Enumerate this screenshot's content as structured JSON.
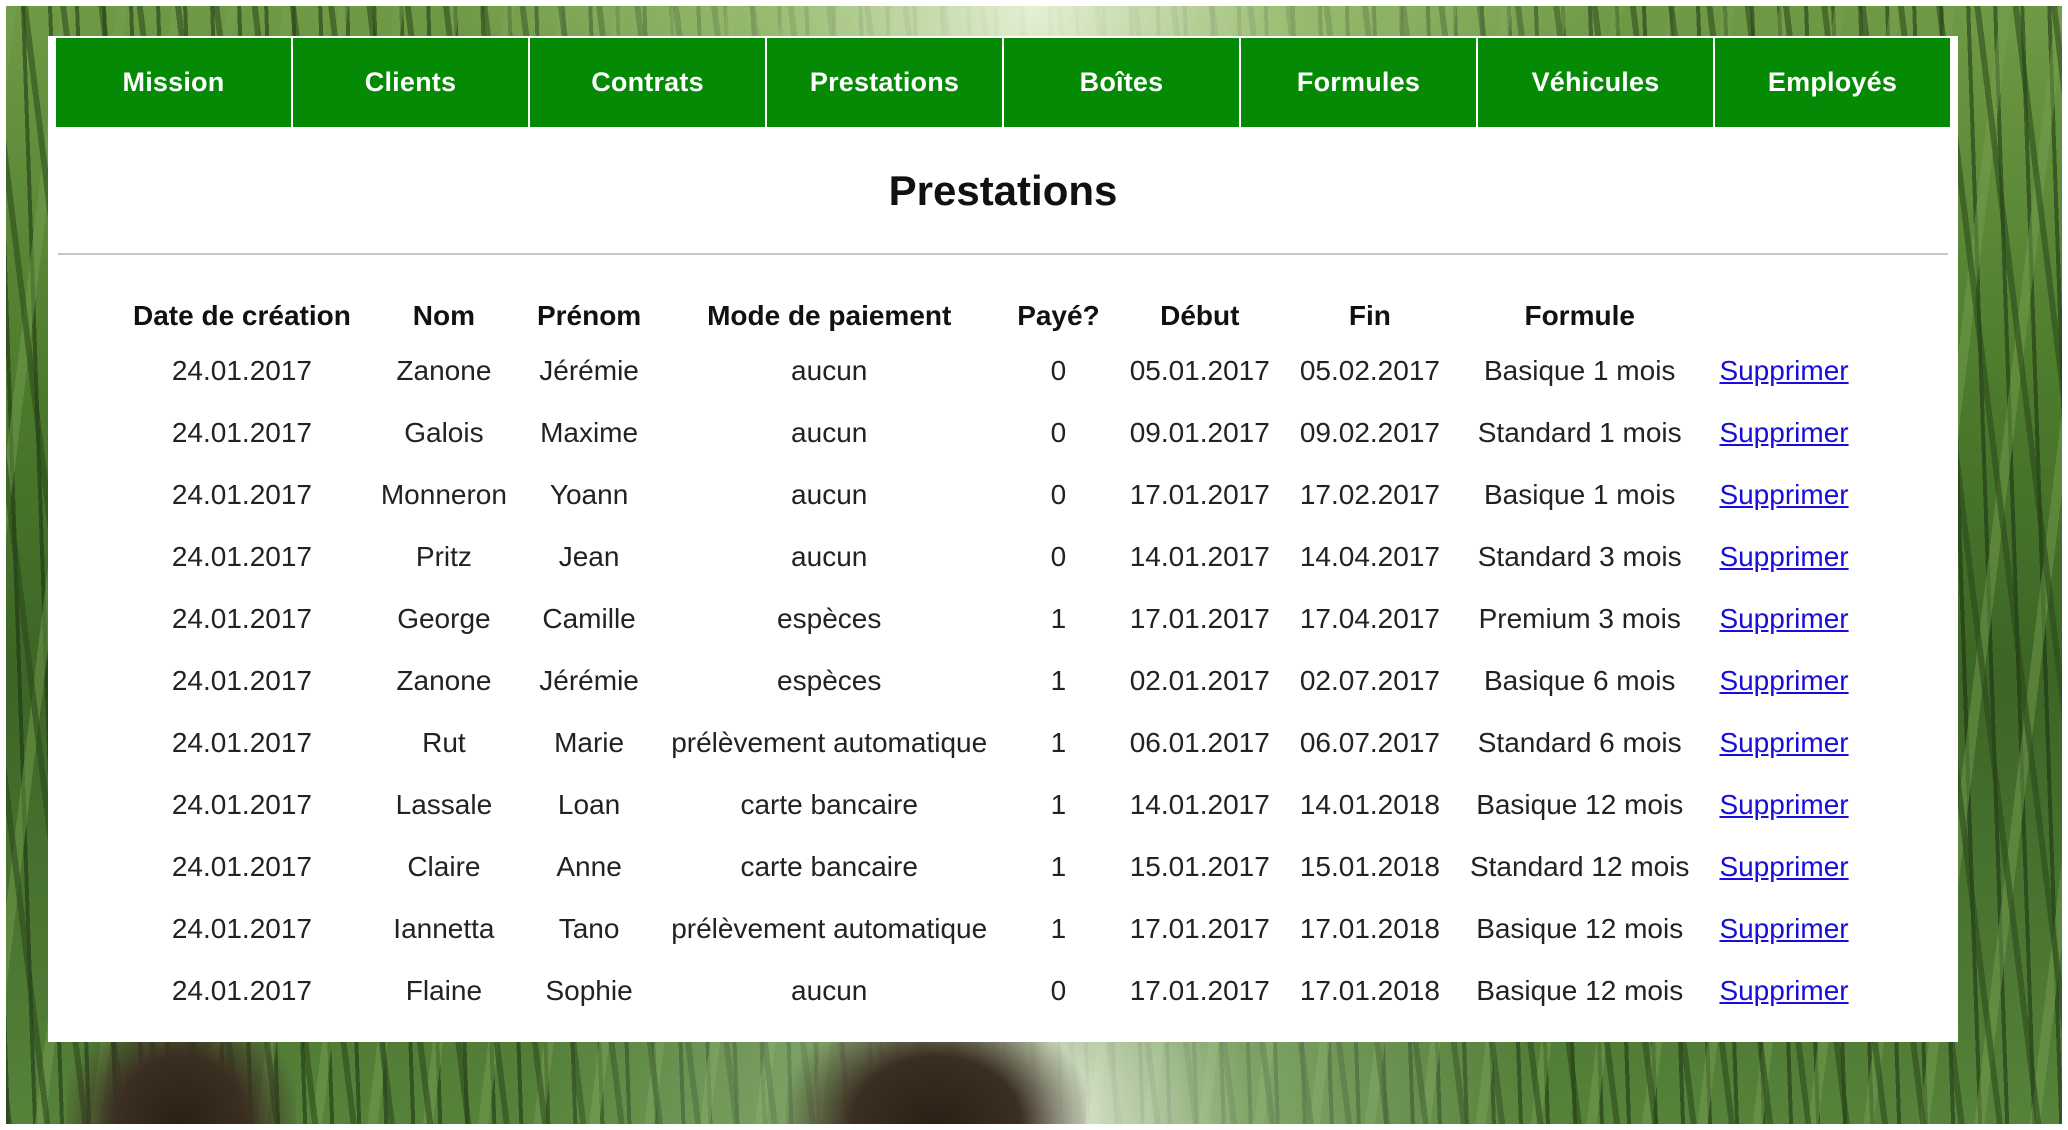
{
  "nav": {
    "items": [
      {
        "label": "Mission"
      },
      {
        "label": "Clients"
      },
      {
        "label": "Contrats"
      },
      {
        "label": "Prestations"
      },
      {
        "label": "Boîtes"
      },
      {
        "label": "Formules"
      },
      {
        "label": "Véhicules"
      },
      {
        "label": "Employés"
      }
    ],
    "color": "#058a05"
  },
  "page": {
    "title": "Prestations"
  },
  "table": {
    "headers": [
      "Date de création",
      "Nom",
      "Prénom",
      "Mode de paiement",
      "Payé?",
      "Début",
      "Fin",
      "Formule",
      ""
    ],
    "rows": [
      {
        "date": "24.01.2017",
        "nom": "Zanone",
        "prenom": "Jérémie",
        "mode": "aucun",
        "paye": "0",
        "debut": "05.01.2017",
        "fin": "05.02.2017",
        "formule": "Basique 1 mois",
        "action": "Supprimer"
      },
      {
        "date": "24.01.2017",
        "nom": "Galois",
        "prenom": "Maxime",
        "mode": "aucun",
        "paye": "0",
        "debut": "09.01.2017",
        "fin": "09.02.2017",
        "formule": "Standard 1 mois",
        "action": "Supprimer"
      },
      {
        "date": "24.01.2017",
        "nom": "Monneron",
        "prenom": "Yoann",
        "mode": "aucun",
        "paye": "0",
        "debut": "17.01.2017",
        "fin": "17.02.2017",
        "formule": "Basique 1 mois",
        "action": "Supprimer"
      },
      {
        "date": "24.01.2017",
        "nom": "Pritz",
        "prenom": "Jean",
        "mode": "aucun",
        "paye": "0",
        "debut": "14.01.2017",
        "fin": "14.04.2017",
        "formule": "Standard 3 mois",
        "action": "Supprimer"
      },
      {
        "date": "24.01.2017",
        "nom": "George",
        "prenom": "Camille",
        "mode": "espèces",
        "paye": "1",
        "debut": "17.01.2017",
        "fin": "17.04.2017",
        "formule": "Premium 3 mois",
        "action": "Supprimer"
      },
      {
        "date": "24.01.2017",
        "nom": "Zanone",
        "prenom": "Jérémie",
        "mode": "espèces",
        "paye": "1",
        "debut": "02.01.2017",
        "fin": "02.07.2017",
        "formule": "Basique 6 mois",
        "action": "Supprimer"
      },
      {
        "date": "24.01.2017",
        "nom": "Rut",
        "prenom": "Marie",
        "mode": "prélèvement automatique",
        "paye": "1",
        "debut": "06.01.2017",
        "fin": "06.07.2017",
        "formule": "Standard 6 mois",
        "action": "Supprimer"
      },
      {
        "date": "24.01.2017",
        "nom": "Lassale",
        "prenom": "Loan",
        "mode": "carte bancaire",
        "paye": "1",
        "debut": "14.01.2017",
        "fin": "14.01.2018",
        "formule": "Basique 12 mois",
        "action": "Supprimer"
      },
      {
        "date": "24.01.2017",
        "nom": "Claire",
        "prenom": "Anne",
        "mode": "carte bancaire",
        "paye": "1",
        "debut": "15.01.2017",
        "fin": "15.01.2018",
        "formule": "Standard 12 mois",
        "action": "Supprimer"
      },
      {
        "date": "24.01.2017",
        "nom": "Iannetta",
        "prenom": "Tano",
        "mode": "prélèvement automatique",
        "paye": "1",
        "debut": "17.01.2017",
        "fin": "17.01.2018",
        "formule": "Basique 12 mois",
        "action": "Supprimer"
      },
      {
        "date": "24.01.2017",
        "nom": "Flaine",
        "prenom": "Sophie",
        "mode": "aucun",
        "paye": "0",
        "debut": "17.01.2017",
        "fin": "17.01.2018",
        "formule": "Basique 12 mois",
        "action": "Supprimer"
      }
    ]
  },
  "colors": {
    "nav_green": "#058a05",
    "link_blue": "#1a0dd9"
  }
}
